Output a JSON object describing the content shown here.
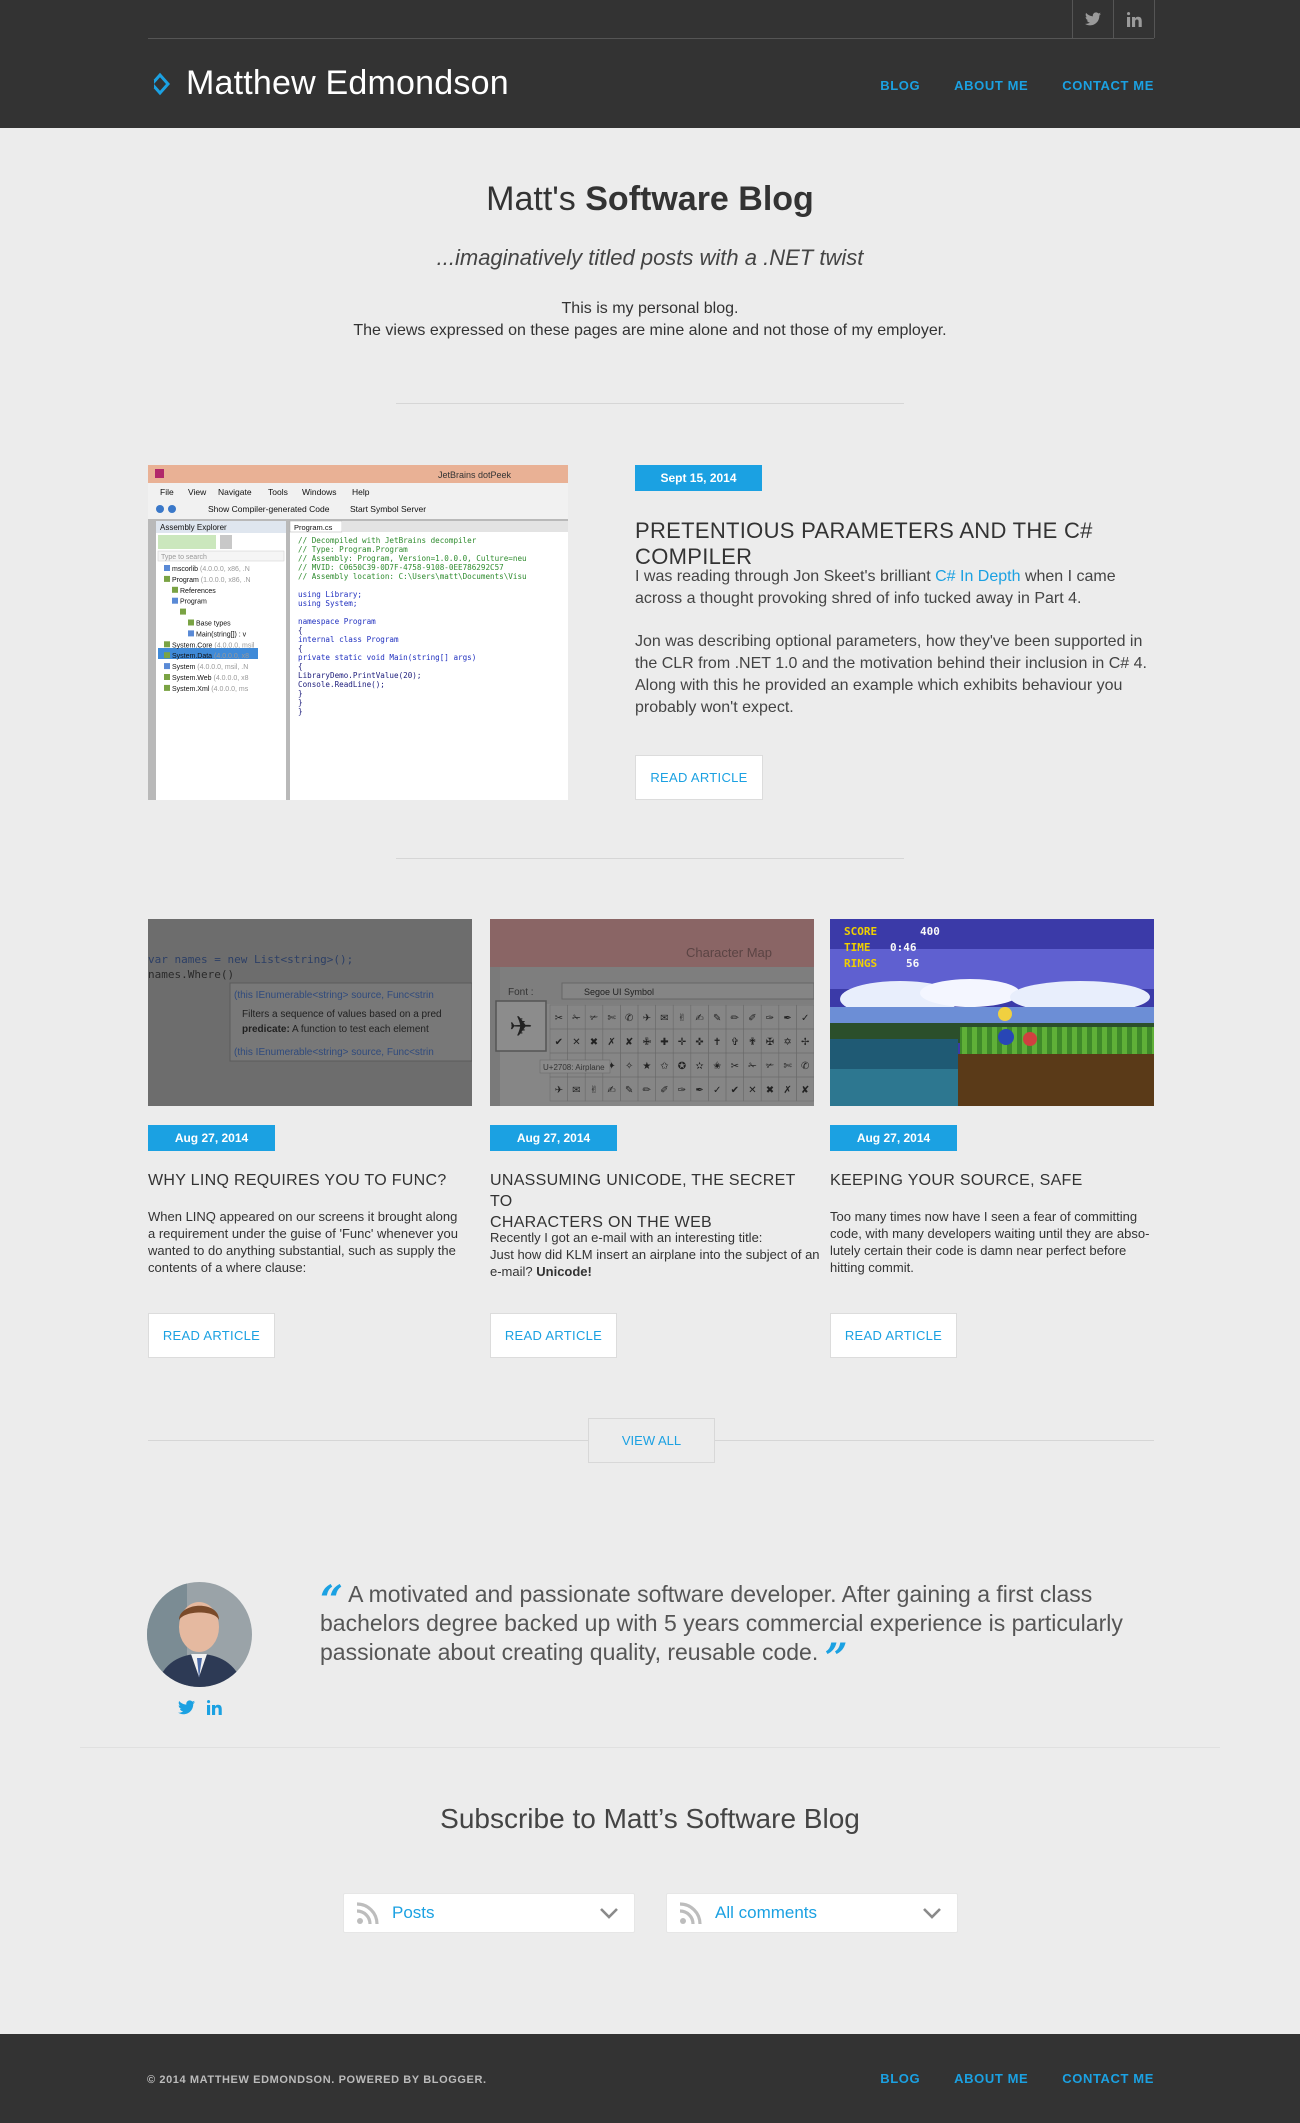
{
  "header": {
    "brand": "Matthew Edmondson",
    "nav": [
      "BLOG",
      "ABOUT ME",
      "CONTACT ME"
    ],
    "social": [
      "twitter-icon",
      "linkedin-icon"
    ],
    "accent": "#1ba1e2",
    "bg": "#333333"
  },
  "hero": {
    "title_prefix": "Matt's",
    "title_bold": "Software Blog",
    "subtitle": "...imaginatively titled posts with a .NET twist",
    "desc_line1": "This is my personal blog.",
    "desc_line2": "The views expressed on these pages are mine alone and not those of my employer."
  },
  "featured": {
    "date": "Sept 15, 2014",
    "title": "PRETENTIOUS PARAMETERS AND THE C# COMPILER",
    "p1_before": "I was reading through Jon Skeet's brilliant ",
    "p1_link": "C# In Depth",
    "p1_after": " when I came across a thought provoking shred of info tucked away in Part 4.",
    "p2": "Jon was describing optional parameters, how they've been supported in the CLR from .NET 1.0 and the motivation behind their inclusion in C# 4. Along with this he provided an example which exhibits behaviour you probably won't expect.",
    "read": "READ ARTICLE",
    "image": {
      "window_title": "JetBrains dotPeek",
      "menu": [
        "File",
        "View",
        "Navigate",
        "Tools",
        "Windows",
        "Help"
      ],
      "toolbar_1": "Show Compiler-generated Code",
      "toolbar_2": "Start Symbol Server",
      "panel_title": "Assembly Explorer",
      "tab": "Program.cs",
      "search_placeholder": "Type to search",
      "tree": [
        {
          "name": "mscorlib",
          "meta": "(4.0.0.0, x86, .N"
        },
        {
          "name": "Program",
          "meta": "(1.0.0.0, x86, .N"
        },
        {
          "name": "References",
          "meta": ""
        },
        {
          "name": "Program",
          "meta": ""
        },
        {
          "name": "Program",
          "meta": ""
        },
        {
          "name": "Base types",
          "meta": ""
        },
        {
          "name": "Main(string[]) : v",
          "meta": ""
        },
        {
          "name": "System.Core",
          "meta": "(4.0.0.0, msil"
        },
        {
          "name": "System.Data",
          "meta": "(4.0.0.0, x8"
        },
        {
          "name": "System",
          "meta": "(4.0.0.0, msil, .N"
        },
        {
          "name": "System.Web",
          "meta": "(4.0.0.0, x8"
        },
        {
          "name": "System.Xml",
          "meta": "(4.0.0.0, ms"
        }
      ],
      "code": [
        "// Decompiled with JetBrains decompiler",
        "// Type: Program.Program",
        "// Assembly: Program, Version=1.0.0.0, Culture=neu",
        "// MVID: C0650C39-0D7F-4758-9108-0EE786292C57",
        "// Assembly location: C:\\Users\\matt\\Documents\\Visu",
        "",
        "using Library;",
        "using System;",
        "",
        "namespace Program",
        "{",
        "  internal class Program",
        "  {",
        "    private static void Main(string[] args)",
        "    {",
        "      LibraryDemo.PrintValue(20);",
        "      Console.ReadLine();",
        "    }",
        "  }",
        "}"
      ]
    }
  },
  "cards": [
    {
      "date": "Aug 27, 2014",
      "title_l1": "WHY LINQ REQUIRES YOU TO FUNC?",
      "title_l2": "",
      "body": "When LINQ appeared on our screens it brought along a requirement under the guise of 'Func' whenever you wanted to do anything substantial, such as supply the contents of a where clause:",
      "read": "READ ARTICLE",
      "image": {
        "code_l1": "var names = new List<string>();",
        "code_l2": "names.Where()",
        "tip_l1": "(this IEnumerable<string> source, Func<strin",
        "tip_l2": "Filters a sequence of values based on a pred",
        "tip_l3_bold": "predicate:",
        "tip_l3": " A function to test each element",
        "tip_l4": "(this IEnumerable<string> source, Func<strin"
      }
    },
    {
      "date": "Aug 27, 2014",
      "title_l1": "UNASSUMING UNICODE, THE SECRET TO",
      "title_l2": "CHARACTERS ON THE WEB",
      "body_l1": "Recently I got an e-mail with an interesting title:",
      "body_l2": "Just how did KLM insert an airplane into the subject of an e-mail?",
      "body_bold": "Unicode!",
      "read": "READ ARTICLE",
      "image": {
        "window_title": "Character Map",
        "font_label": "Font :",
        "font_value": "Segoe UI Symbol",
        "tooltip": "U+2708: Airplane"
      }
    },
    {
      "date": "Aug 27, 2014",
      "title_l1": "KEEPING YOUR SOURCE, SAFE",
      "title_l2": "",
      "body": "Too many times now have I seen a fear of committing code, with many developers waiting until they are abso-lutely certain their code is damn near perfect before hitting commit.",
      "read": "READ ARTICLE",
      "image": {
        "score_label": "SCORE",
        "score_value": "400",
        "time_label": "TIME",
        "time_value": "0:46",
        "rings_label": "RINGS",
        "rings_value": "56"
      }
    }
  ],
  "view_all": "VIEW ALL",
  "about": {
    "quote": "A motivated and passionate software developer. After gaining a first class bachelors degree backed up with 5 years commercial experience is particularly passionate about creating quality, reusable code."
  },
  "subscribe": {
    "title": "Subscribe to Matt’s Software Blog",
    "options": [
      "Posts",
      "All comments"
    ]
  },
  "footer": {
    "copyright": "© 2014 MATTHEW EDMONDSON. POWERED BY BLOGGER.",
    "nav": [
      "BLOG",
      "ABOUT ME",
      "CONTACT ME"
    ]
  }
}
